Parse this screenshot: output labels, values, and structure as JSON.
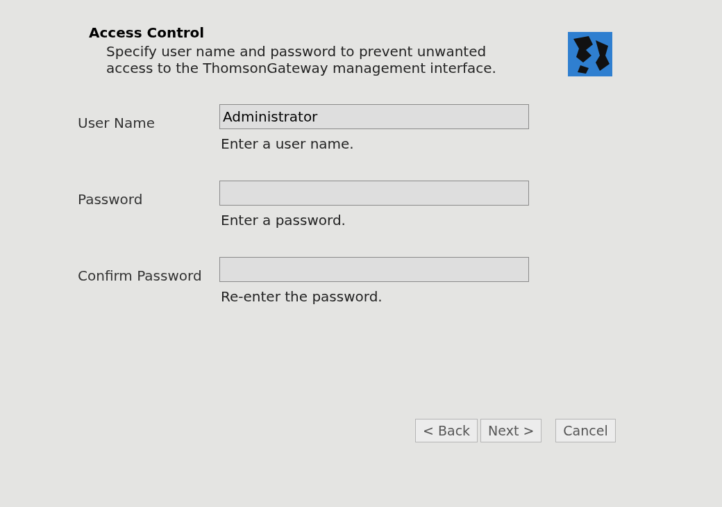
{
  "header": {
    "title": "Access Control",
    "description": "Specify user name and password to prevent unwanted access to the ThomsonGateway management interface."
  },
  "fields": [
    {
      "label": "User Name",
      "value": "Administrator",
      "hint": "Enter a user name."
    },
    {
      "label": "Password",
      "hint": "Enter a password."
    },
    {
      "label": "Confirm Password",
      "hint": "Re-enter the password."
    }
  ],
  "buttons": [
    "< Back",
    "Next >",
    "Cancel"
  ]
}
